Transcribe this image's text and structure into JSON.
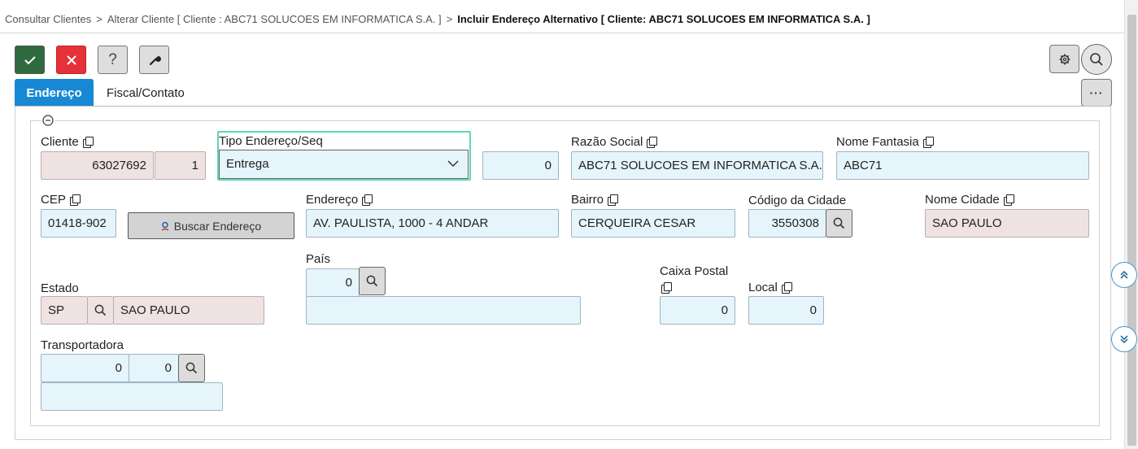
{
  "breadcrumb": {
    "item1": "Consultar Clientes",
    "sep": ">",
    "item2": "Alterar Cliente [ Cliente : ABC71 SOLUCOES EM INFORMATICA S.A. ]",
    "current": "Incluir Endereço Alternativo [ Cliente: ABC71 SOLUCOES EM INFORMATICA S.A. ]"
  },
  "toolbar": {
    "confirm_icon": "check-icon",
    "cancel_icon": "close-icon",
    "help_icon": "question-icon",
    "tools_icon": "wrench-icon",
    "settings_icon": "gear-icon",
    "search_icon": "search-icon",
    "more_label": "···"
  },
  "tabs": [
    {
      "label": "Endereço",
      "active": true
    },
    {
      "label": "Fiscal/Contato",
      "active": false
    }
  ],
  "form": {
    "cliente": {
      "label": "Cliente",
      "code": "63027692",
      "seq": "1"
    },
    "tipo_endereco": {
      "label": "Tipo Endereço/Seq",
      "value": "Entrega",
      "seq": "0"
    },
    "razao_social": {
      "label": "Razão Social",
      "value": "ABC71 SOLUCOES EM INFORMATICA S.A."
    },
    "nome_fantasia": {
      "label": "Nome Fantasia",
      "value": "ABC71"
    },
    "cep": {
      "label": "CEP",
      "value": "01418-902"
    },
    "buscar_endereco": {
      "label": "Buscar Endereço"
    },
    "endereco": {
      "label": "Endereço",
      "value": "AV. PAULISTA, 1000 - 4 ANDAR"
    },
    "bairro": {
      "label": "Bairro",
      "value": "CERQUEIRA CESAR"
    },
    "codigo_cidade": {
      "label": "Código da Cidade",
      "value": "3550308"
    },
    "nome_cidade": {
      "label": "Nome Cidade",
      "value": "SAO PAULO"
    },
    "pais": {
      "label": "País",
      "code": "0",
      "name": ""
    },
    "caixa_postal": {
      "label": "Caixa Postal",
      "value": "0"
    },
    "local": {
      "label": "Local",
      "value": "0"
    },
    "estado": {
      "label": "Estado",
      "code": "SP",
      "name": "SAO PAULO"
    },
    "transportadora": {
      "label": "Transportadora",
      "code1": "0",
      "code2": "0",
      "name": ""
    }
  },
  "colors": {
    "accent": "#1788d4",
    "confirm": "#2f6a3f",
    "cancel": "#e53238",
    "input_bg": "#e6f4fb",
    "readonly_bg": "#eee2e2",
    "focus": "#5fd6b9"
  }
}
